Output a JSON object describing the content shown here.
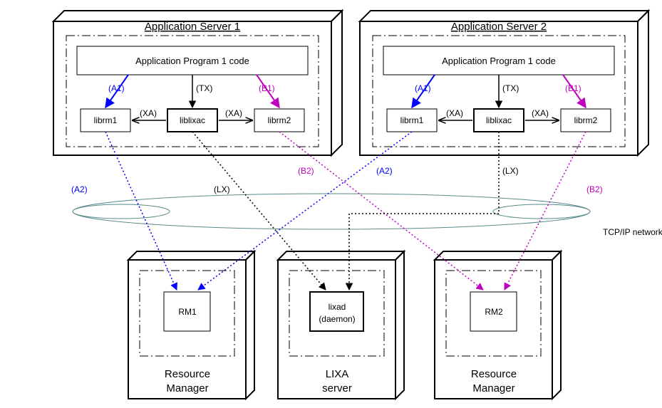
{
  "servers": {
    "as1": {
      "title": "Application Server 1",
      "app_code": "Application Program 1 code"
    },
    "as2": {
      "title": "Application Server 2",
      "app_code": "Application Program 1 code"
    }
  },
  "libs": {
    "librm1_a": "librm1",
    "liblixac_a": "liblixac",
    "librm2_a": "librm2",
    "librm1_b": "librm1",
    "liblixac_b": "liblixac",
    "librm2_b": "librm2"
  },
  "labels": {
    "a1_a": "(A1)",
    "tx_a": "(TX)",
    "b1_a": "(B1)",
    "xa_a1": "(XA)",
    "xa_a2": "(XA)",
    "a1_b": "(A1)",
    "tx_b": "(TX)",
    "b1_b": "(B1)",
    "xa_b1": "(XA)",
    "xa_b2": "(XA)",
    "a2_a": "(A2)",
    "lx_a": "(LX)",
    "b2_a": "(B2)",
    "a2_b": "(A2)",
    "lx_b": "(LX)",
    "b2_b": "(B2)",
    "tcpip": "TCP/IP network"
  },
  "bottom": {
    "rm1": {
      "box": "RM1",
      "title1": "Resource",
      "title2": "Manager"
    },
    "lixa": {
      "box1": "lixad",
      "box2": "(daemon)",
      "title1": "LIXA",
      "title2": "server"
    },
    "rm2": {
      "box": "RM2",
      "title1": "Resource",
      "title2": "Manager"
    }
  },
  "colors": {
    "blue": "#0000ff",
    "magenta": "#c000c0",
    "black": "#000000",
    "teal": "#5a8a8a"
  }
}
